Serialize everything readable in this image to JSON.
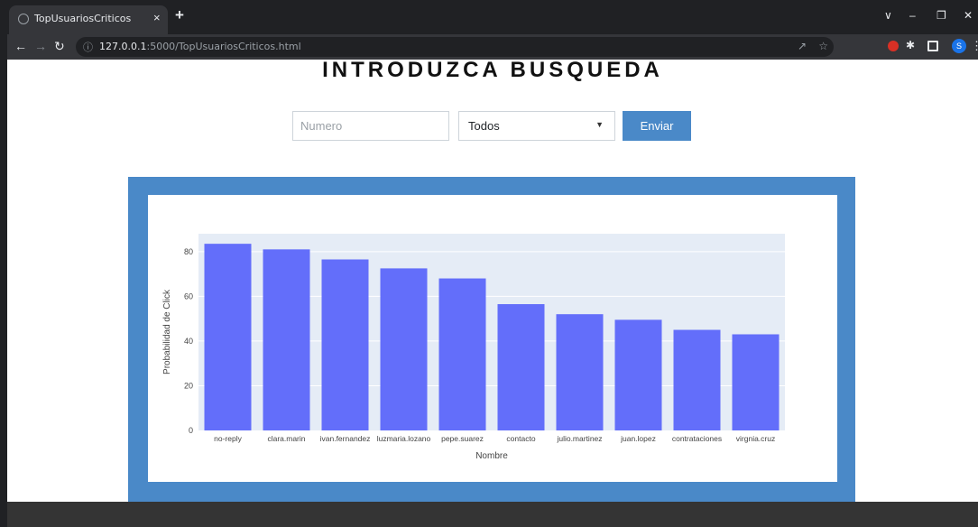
{
  "browser": {
    "tab_title": "TopUsuariosCriticos",
    "tab_close": "×",
    "new_tab": "+",
    "url_host": "127.0.0.1",
    "url_rest": ":5000/TopUsuariosCriticos.html",
    "profile_initial": "S"
  },
  "page": {
    "heading": "INTRODUZCA BUSQUEDA",
    "number_input_placeholder": "Numero",
    "number_input_value": "",
    "select_value": "Todos",
    "submit_label": "Enviar"
  },
  "chart_data": {
    "type": "bar",
    "title": "",
    "xlabel": "Nombre",
    "ylabel": "Probabilidad de Click",
    "categories": [
      "no-reply",
      "clara.marin",
      "ivan.fernandez",
      "luzmaria.lozano",
      "pepe.suarez",
      "contacto",
      "julio.martinez",
      "juan.lopez",
      "contrataciones",
      "virgnia.cruz"
    ],
    "values": [
      83.5,
      81,
      76.5,
      72.5,
      68,
      56.5,
      52,
      49.5,
      45,
      43
    ],
    "ylim": [
      0,
      88
    ],
    "yticks": [
      0,
      20,
      40,
      60,
      80
    ],
    "grid": true,
    "colors": {
      "bar": "#636efa",
      "plot_bg": "#e5ecf6",
      "gridline": "#ffffff",
      "axis_text": "#444444"
    }
  },
  "colors": {
    "accent": "#4a89c8",
    "footer": "#343434",
    "chrome_dark": "#202124",
    "chrome_toolbar": "#35363a"
  }
}
